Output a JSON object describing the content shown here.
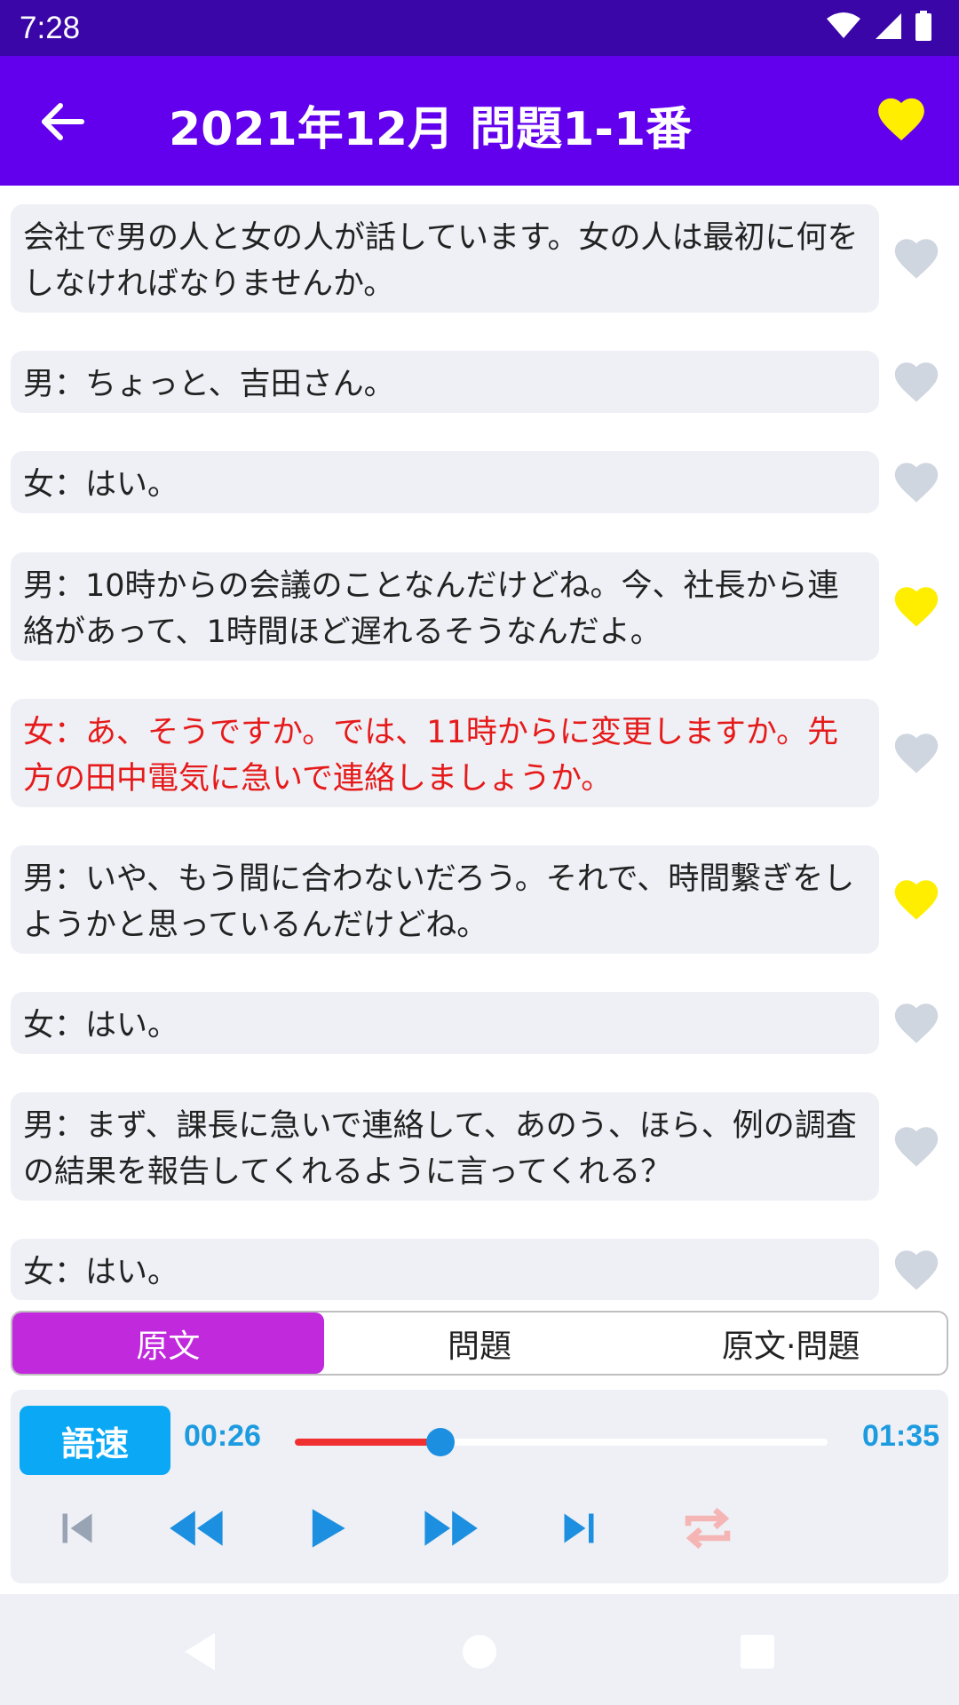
{
  "status_bar": {
    "time": "7:28",
    "icons": [
      "wifi-icon",
      "signal-icon",
      "battery-icon"
    ]
  },
  "app_bar": {
    "title": "2021年12月 問題1-1番",
    "back_icon": "arrow-left-icon",
    "favorite_icon": "heart-icon",
    "favorite_color": "#ffee00"
  },
  "transcript": [
    {
      "text": "会社で男の人と女の人が話しています。女の人は最初に何をしなければなりませんか。",
      "favorited": false,
      "highlight": false
    },
    {
      "text": "男：ちょっと、吉田さん。",
      "favorited": false,
      "highlight": false
    },
    {
      "text": "女：はい。",
      "favorited": false,
      "highlight": false
    },
    {
      "text": "男：10時からの会議のことなんだけどね。今、社長から連絡があって、1時間ほど遅れるそうなんだよ。",
      "favorited": true,
      "highlight": false
    },
    {
      "text": "女：あ、そうですか。では、11時からに変更しますか。先方の田中電気に急いで連絡しましょうか。",
      "favorited": false,
      "highlight": true
    },
    {
      "text": "男：いや、もう間に合わないだろう。それで、時間繋ぎをしようかと思っているんだけどね。",
      "favorited": true,
      "highlight": false
    },
    {
      "text": "女：はい。",
      "favorited": false,
      "highlight": false
    },
    {
      "text": "男：まず、課長に急いで連絡して、あのう、ほら、例の調査の結果を報告してくれるように言ってくれる？",
      "favorited": false,
      "highlight": false
    },
    {
      "text": "女：はい。",
      "favorited": false,
      "highlight": false
    }
  ],
  "tabs": [
    {
      "label": "原文",
      "active": true
    },
    {
      "label": "問題",
      "active": false
    },
    {
      "label": "原文·問題",
      "active": false
    }
  ],
  "player": {
    "speed_label": "語速",
    "current_time": "00:26",
    "total_time": "01:35",
    "progress": 0.274,
    "controls": [
      "skip-previous-icon",
      "rewind-icon",
      "play-icon",
      "fast-forward-icon",
      "skip-next-icon",
      "repeat-icon"
    ]
  },
  "colors": {
    "status_bar": "#3a06a8",
    "app_bar": "#6200ee",
    "heart_active": "#ffee00",
    "heart_inactive": "#cfd6e0",
    "highlight_text": "#e61a1a",
    "tab_active": "#c02adc",
    "speed_button": "#0aa8f5",
    "time_text": "#1d9be0",
    "seek_fill": "#f03030",
    "repeat_icon": "#f5b5b5"
  }
}
